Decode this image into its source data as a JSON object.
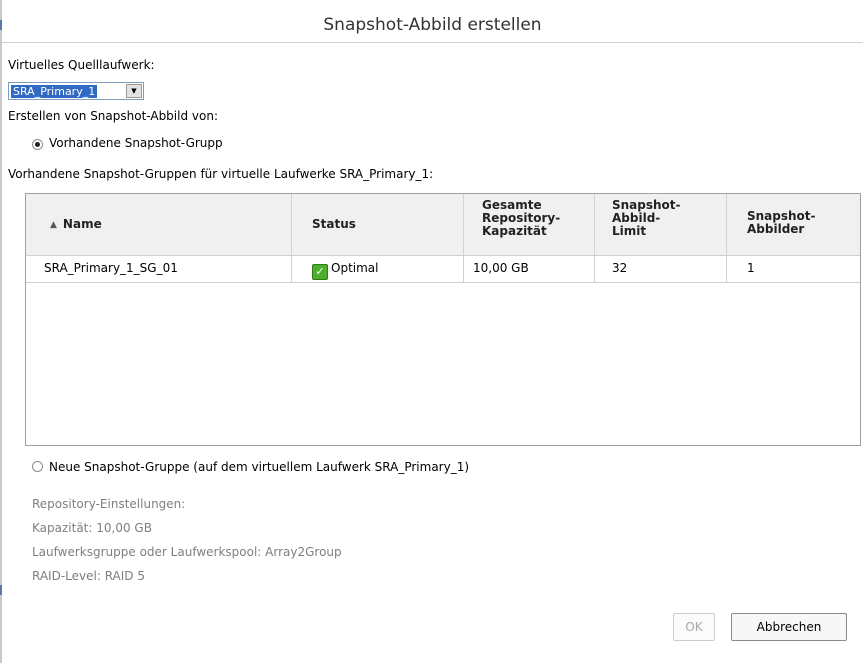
{
  "window": {
    "title": "Snapshot-Abbild erstellen"
  },
  "source": {
    "label": "Virtuelles Quelllaufwerk:",
    "selected": "SRA_Primary_1"
  },
  "create_from_label": "Erstellen von Snapshot-Abbild von:",
  "option_existing": {
    "label": "Vorhandene Snapshot-Grupp",
    "checked": true
  },
  "existing_groups_label": "Vorhandene Snapshot-Gruppen für virtuelle Laufwerke  SRA_Primary_1:",
  "table": {
    "columns": [
      "Name",
      "Status",
      "Gesamte Repository-Kapazität",
      "Snapshot-Abbild-Limit",
      "Snapshot-Abbilder"
    ],
    "sort_column": "Name",
    "sort_direction": "ascending",
    "rows": [
      {
        "name": "SRA_Primary_1_SG_01",
        "status": "Optimal",
        "capacity": "10,00 GB",
        "limit": "32",
        "images": "1"
      }
    ]
  },
  "option_new": {
    "label": "Neue Snapshot-Gruppe (auf dem virtuellem Laufwerk SRA_Primary_1)",
    "checked": false
  },
  "repository": {
    "heading": "Repository-Einstellungen:",
    "capacity": "Kapazität: 10,00 GB",
    "pool": "Laufwerksgruppe oder Laufwerkspool: Array2Group",
    "raid": "RAID-Level: RAID 5"
  },
  "buttons": {
    "ok": "OK",
    "cancel": "Abbrechen"
  },
  "colors": {
    "selection": "#316ac5",
    "status_ok": "#4caf2d",
    "disabled_text": "#a8a8a8"
  },
  "icons": {
    "status_ok": "checkmark-icon",
    "sort": "sort-ascending-icon",
    "dropdown": "chevron-down-icon"
  }
}
